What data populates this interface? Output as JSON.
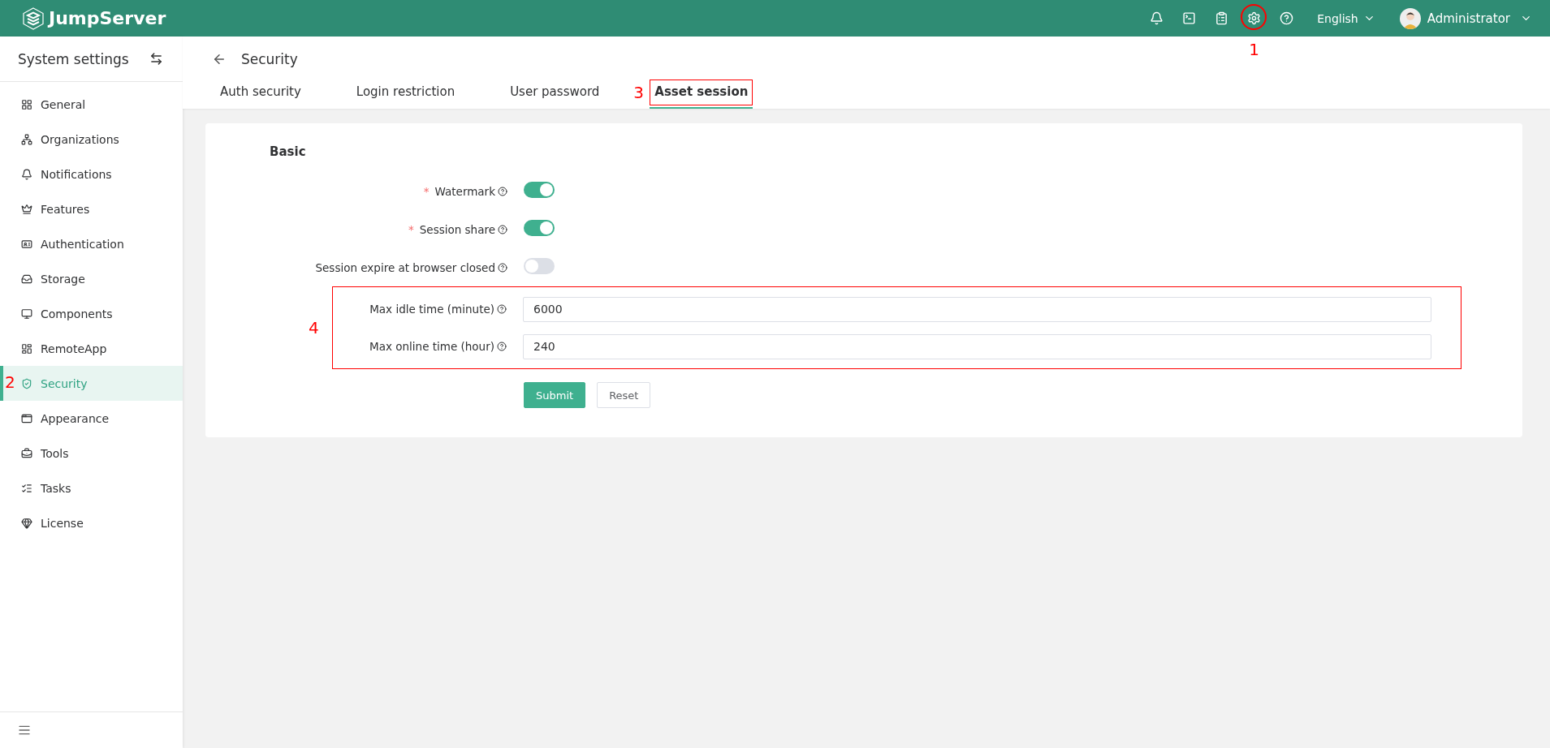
{
  "header": {
    "logo_text": "JumpServer",
    "language": "English",
    "user": "Administrator"
  },
  "sidebar": {
    "title": "System settings",
    "items": [
      {
        "label": "General",
        "selected": false
      },
      {
        "label": "Organizations",
        "selected": false
      },
      {
        "label": "Notifications",
        "selected": false
      },
      {
        "label": "Features",
        "selected": false
      },
      {
        "label": "Authentication",
        "selected": false
      },
      {
        "label": "Storage",
        "selected": false
      },
      {
        "label": "Components",
        "selected": false
      },
      {
        "label": "RemoteApp",
        "selected": false
      },
      {
        "label": "Security",
        "selected": true
      },
      {
        "label": "Appearance",
        "selected": false
      },
      {
        "label": "Tools",
        "selected": false
      },
      {
        "label": "Tasks",
        "selected": false
      },
      {
        "label": "License",
        "selected": false
      }
    ]
  },
  "page": {
    "title": "Security",
    "tabs": [
      {
        "label": "Auth security",
        "selected": false
      },
      {
        "label": "Login restriction",
        "selected": false
      },
      {
        "label": "User password",
        "selected": false
      },
      {
        "label": "Asset session",
        "selected": true
      }
    ],
    "section": "Basic",
    "fields": [
      {
        "kind": "switch",
        "required_mark": "*",
        "label": "Watermark",
        "on": true
      },
      {
        "kind": "switch",
        "required_mark": "*",
        "label": "Session share",
        "on": true
      },
      {
        "kind": "switch",
        "label": "Session expire at browser closed",
        "on": false
      },
      {
        "kind": "input",
        "label": "Max idle time (minute)",
        "value": "6000"
      },
      {
        "kind": "input",
        "label": "Max online time (hour)",
        "value": "240"
      }
    ],
    "buttons": [
      {
        "kind": "primary",
        "label": "Submit"
      },
      {
        "kind": "plain",
        "label": "Reset"
      }
    ]
  },
  "annotations": {
    "settings_icon": "1",
    "sidebar_item": "2",
    "tab": "3",
    "inputs": "4"
  }
}
